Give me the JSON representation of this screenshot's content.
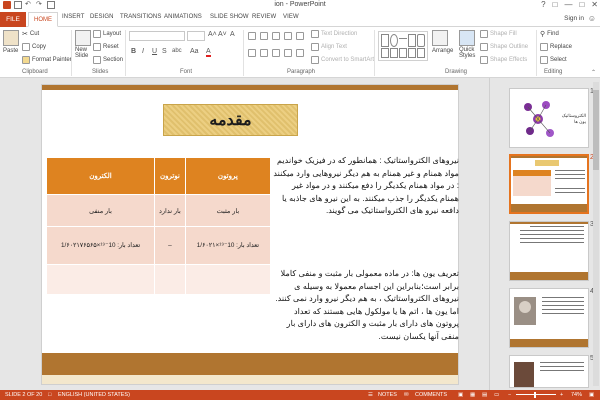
{
  "window": {
    "title": "ion - PowerPoint",
    "sign_in": "Sign in",
    "minimize": "—",
    "maximize": "□",
    "close": "✕",
    "help": "?"
  },
  "tabs": [
    "HOME",
    "INSERT",
    "DESIGN",
    "TRANSITIONS",
    "ANIMATIONS",
    "SLIDE SHOW",
    "REVIEW",
    "VIEW"
  ],
  "file_tab": "FILE",
  "ribbon": {
    "clipboard": {
      "label": "Clipboard",
      "paste": "Paste",
      "cut": "Cut",
      "copy": "Copy",
      "format_painter": "Format Painter"
    },
    "slides": {
      "label": "Slides",
      "new_slide": "New",
      "new_slide2": "Slide",
      "layout": "Layout",
      "reset": "Reset",
      "section": "Section"
    },
    "font": {
      "label": "Font",
      "bold": "B",
      "italic": "I",
      "underline": "U",
      "strike": "S",
      "spacing": "abc",
      "grow": "A˄",
      "shrink": "A˅",
      "clear": "A",
      "case": "Aa",
      "color": "A"
    },
    "paragraph": {
      "label": "Paragraph",
      "text_direction": "Text Direction",
      "align_text": "Align Text",
      "smartart": "Convert to SmartArt"
    },
    "drawing": {
      "label": "Drawing",
      "arrange": "Arrange",
      "quick_styles": "Quick",
      "quick_styles2": "Styles",
      "shape_fill": "Shape Fill",
      "shape_outline": "Shape Outline",
      "shape_effects": "Shape Effects"
    },
    "editing": {
      "label": "Editing",
      "find": "Find",
      "replace": "Replace",
      "select": "Select"
    }
  },
  "slide": {
    "title": "مقدمه",
    "table": {
      "headers": [
        "الکترون",
        "نوترون",
        "پروتون"
      ],
      "rows": [
        [
          "بار منفی",
          "بار ندارد",
          "بار مثبت"
        ],
        [
          "تعداد بار: 10⁻¹⁹×1/۶۰۲۱۷۶۵۶۵",
          "–",
          "تعداد بار: 10⁻¹⁹×1/۶۰۲۱"
        ],
        [
          "",
          "",
          ""
        ]
      ]
    },
    "paragraph1": "نیروهای الکترواستاتیک : همانطور که در فیزیک خواندیم مواد همنام و غیر همنام به هم دیگر نیروهایی وارد میکنند : در مواد همنام یکدیگر را دفع میکنند و در مواد غیر همنام یکدیگر را جذب میکنند. به این نیرو های جاذبه یا دافعه نیرو های الکترواستاتیک می گویند.",
    "paragraph2": "تعریف یون ها: در ماده معمولی بار مثبت و منفی کاملا برابر است؛بنابراین این اجسام معمولا به وسیله ی نیروهای الکترواستاتیک ، به هم دیگر نیرو وارد نمی کنند. اما یون ها ، اتم ها یا مولکول هایی هستند که تعداد پروتون های دارای بار مثبت و الکترون های دارای بار منفی آنها یکسان نیست."
  },
  "thumbnails": {
    "numbers": [
      "1",
      "2",
      "3",
      "4",
      "5"
    ],
    "selected": "2",
    "thumb1_title": "الکتروستاتیک یون ها"
  },
  "status": {
    "slide": "SLIDE 2 OF 20",
    "language": "ENGLISH (UNITED STATES)",
    "notes": "NOTES",
    "comments": "COMMENTS",
    "zoom": "74%"
  },
  "colors": {
    "accent": "#c9461f",
    "table_header": "#de8320",
    "table_cell": "#f5d9cc",
    "slide_bar": "#b07530",
    "title_box": "#e9c871"
  }
}
